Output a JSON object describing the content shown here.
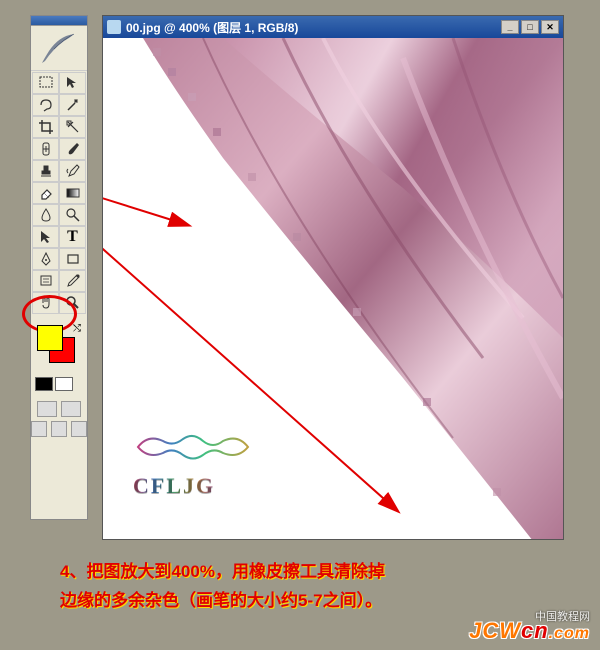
{
  "window": {
    "title": "00.jpg @ 400% (图层 1, RGB/8)"
  },
  "toolbox": {
    "tools": [
      {
        "name": "marquee",
        "glyph": "▭"
      },
      {
        "name": "move",
        "glyph": "↖"
      },
      {
        "name": "lasso",
        "glyph": "⊙"
      },
      {
        "name": "magic-wand",
        "glyph": "✦"
      },
      {
        "name": "crop",
        "glyph": "✂"
      },
      {
        "name": "slice",
        "glyph": "▨"
      },
      {
        "name": "healing",
        "glyph": "◍"
      },
      {
        "name": "brush",
        "glyph": "🖌"
      },
      {
        "name": "stamp",
        "glyph": "⊞"
      },
      {
        "name": "history-brush",
        "glyph": "↺"
      },
      {
        "name": "eraser",
        "glyph": "⌫"
      },
      {
        "name": "gradient",
        "glyph": "▦"
      },
      {
        "name": "blur",
        "glyph": "△"
      },
      {
        "name": "dodge",
        "glyph": "○"
      },
      {
        "name": "path-select",
        "glyph": "↗"
      },
      {
        "name": "type",
        "glyph": "T"
      },
      {
        "name": "pen",
        "glyph": "✒"
      },
      {
        "name": "shape",
        "glyph": "◻"
      },
      {
        "name": "notes",
        "glyph": "▭"
      },
      {
        "name": "eyedropper",
        "glyph": "✎"
      },
      {
        "name": "hand",
        "glyph": "✋"
      },
      {
        "name": "zoom",
        "glyph": "🔍"
      }
    ],
    "colors": {
      "foreground": "#ffff00",
      "background": "#ff0000"
    }
  },
  "instruction": {
    "number": "4、",
    "line1": "把图放大到400%，用橡皮擦工具清除掉",
    "line2": "边缘的多余杂色（画笔的大小约5-7之间）。"
  },
  "watermarks": {
    "text1": "中国教程网",
    "logo_main": "JCW",
    "logo_sub": "cn",
    "logo_dot": ".com"
  },
  "canvas_logo": {
    "text": "CFLJG"
  }
}
